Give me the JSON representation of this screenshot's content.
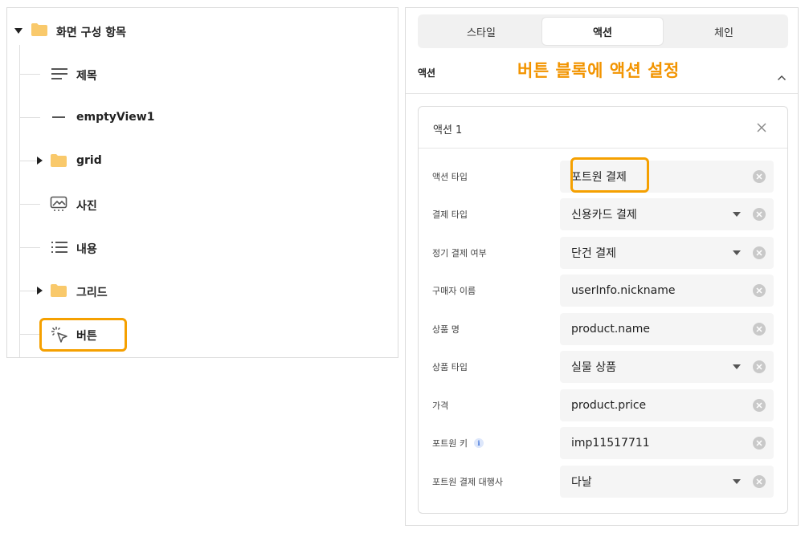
{
  "tree": {
    "root": {
      "label": "화면 구성 항목",
      "icon": "folder-icon"
    },
    "items": [
      {
        "label": "제목",
        "icon": "text-lines-icon",
        "expandable": false
      },
      {
        "label": "emptyView1",
        "icon": "dash-icon",
        "expandable": false
      },
      {
        "label": "grid",
        "icon": "folder-icon",
        "expandable": true
      },
      {
        "label": "사진",
        "icon": "image-icon",
        "expandable": false
      },
      {
        "label": "내용",
        "icon": "list-icon",
        "expandable": false
      },
      {
        "label": "그리드",
        "icon": "folder-icon",
        "expandable": true
      },
      {
        "label": "버튼",
        "icon": "cursor-click-icon",
        "expandable": false,
        "highlighted": true
      }
    ]
  },
  "tabs": [
    {
      "label": "스타일",
      "active": false
    },
    {
      "label": "액션",
      "active": true
    },
    {
      "label": "체인",
      "active": false
    }
  ],
  "section": {
    "title": "액션"
  },
  "annotation": "버튼 블록에 액션 설정",
  "action_card": {
    "title": "액션 1",
    "fields": [
      {
        "label": "액션 타입",
        "value": "포트원 결제",
        "dropdown": false
      },
      {
        "label": "결제 타입",
        "value": "신용카드 결제",
        "dropdown": true
      },
      {
        "label": "정기 결제 여부",
        "value": "단건 결제",
        "dropdown": true
      },
      {
        "label": "구매자 이름",
        "value": "userInfo.nickname",
        "dropdown": false
      },
      {
        "label": "상품 명",
        "value": "product.name",
        "dropdown": false
      },
      {
        "label": "상품 타입",
        "value": "실물 상품",
        "dropdown": true
      },
      {
        "label": "가격",
        "value": "product.price",
        "dropdown": false
      },
      {
        "label": "포트원 키",
        "value": "imp11517711",
        "dropdown": false,
        "info": "i"
      },
      {
        "label": "포트원 결제 대행사",
        "value": "다날",
        "dropdown": true
      }
    ]
  },
  "colors": {
    "accent": "#f29400",
    "highlight_border": "#f5a000",
    "folder": "#f9c96b"
  }
}
